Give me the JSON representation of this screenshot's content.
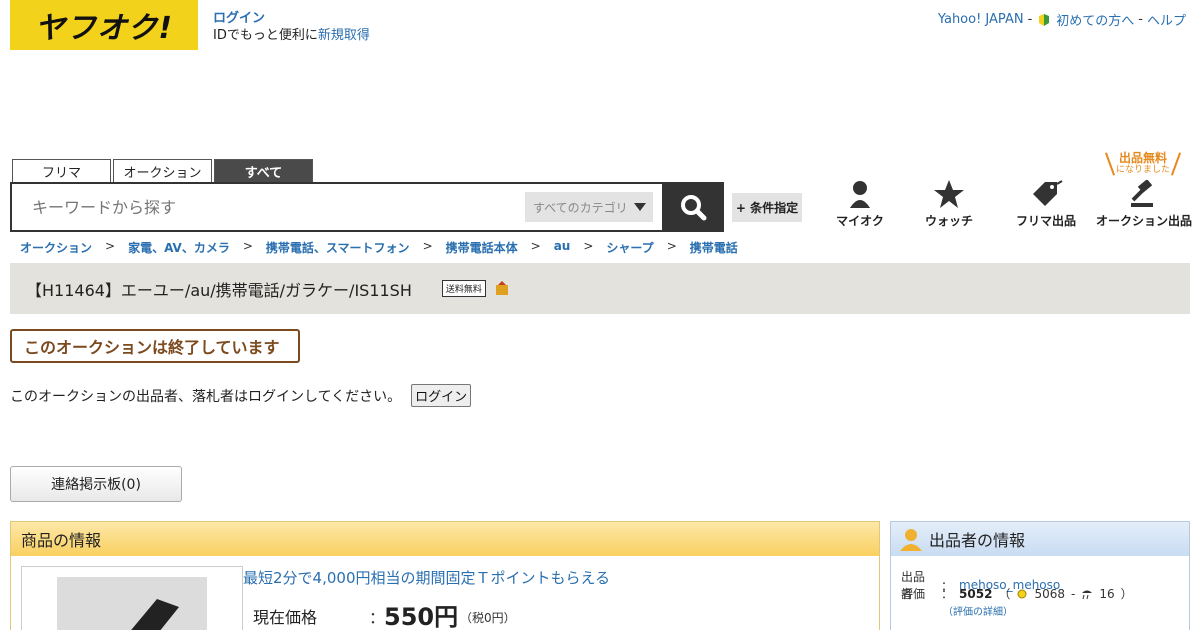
{
  "header": {
    "logo_text": "ヤフオク!",
    "login_label": "ログイン",
    "id_text": "IDでもっと便利に",
    "signup_label": "新規取得",
    "top_links": {
      "yahoo_japan": "Yahoo! JAPAN",
      "sep1": "-",
      "first_time": "初めての方へ",
      "sep2": "-",
      "help": "ヘルプ"
    }
  },
  "search": {
    "tabs": [
      {
        "label": "フリマ",
        "active": false
      },
      {
        "label": "オークション",
        "active": false
      },
      {
        "label": "すべて",
        "active": true
      }
    ],
    "placeholder": "キーワードから探す",
    "category": "すべてのカテゴリ",
    "condition_label": "+ 条件指定"
  },
  "nav": {
    "myauc": "マイオク",
    "watch": "ウォッチ",
    "flea_sell": "フリマ出品",
    "auction_sell": "オークション出品",
    "free_badge": "出品無料",
    "free_badge_sub": "になりました"
  },
  "breadcrumb": [
    "オークション",
    "家電、AV、カメラ",
    "携帯電話、スマートフォン",
    "携帯電話本体",
    "au",
    "シャープ",
    "携帯電話"
  ],
  "breadcrumb_sep": ">",
  "item": {
    "title": "【H11464】エーユー/au/携帯電話/ガラケー/IS11SH",
    "free_shipping_badge": "送料無料",
    "ended_text": "このオークションは終了しています",
    "login_message": "このオークションの出品者、落札者はログインしてください。",
    "login_button": "ログイン",
    "board_button": "連絡掲示板(0)"
  },
  "item_info": {
    "heading": "商品の情報",
    "promo": "最短2分で4,000円相当の期間固定Ｔポイントもらえる",
    "price_label": "現在価格",
    "colon": "：",
    "price": "550円",
    "tax": "（税0円）"
  },
  "seller": {
    "heading": "出品者の情報",
    "seller_label": "出品者",
    "colon": "：",
    "seller_name": "mehoso_mehoso",
    "rating_label": "評価",
    "rating_total": "5052",
    "rating_good": "5068",
    "rating_sep": "-",
    "rating_bad": "16",
    "rating_open": "（",
    "rating_close": "）",
    "rating_detail": "（評価の詳細）"
  },
  "colors": {
    "logo_bg": "#f2d21b",
    "link": "#2a6fb0",
    "ended": "#7b4a1f",
    "free_badge": "#e58a1e"
  }
}
